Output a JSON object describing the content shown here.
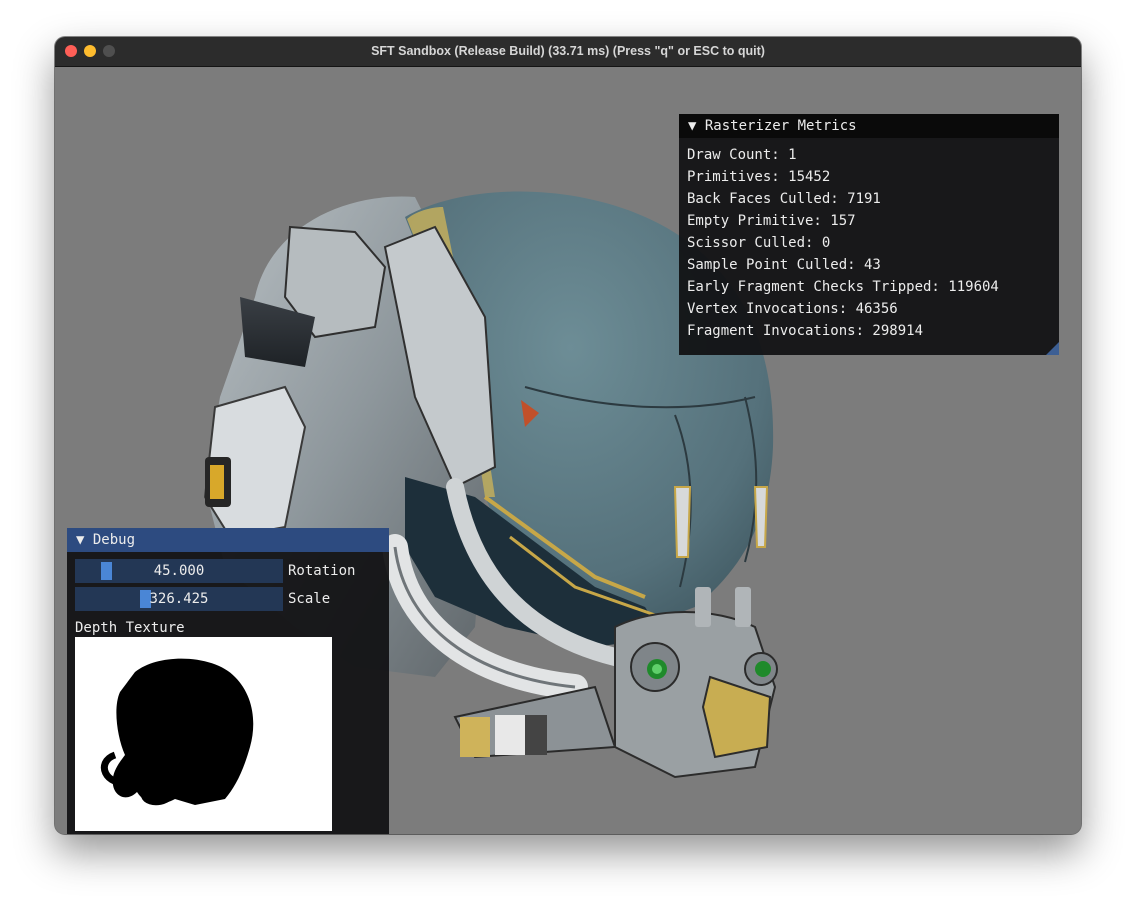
{
  "window": {
    "title": "SFT Sandbox (Release Build) (33.71 ms) (Press \"q\" or ESC to quit)"
  },
  "metrics_panel": {
    "header": "▼ Rasterizer Metrics",
    "rows": [
      "Draw Count: 1",
      "Primitives: 15452",
      "Back Faces Culled: 7191",
      "Empty Primitive: 157",
      "Scissor Culled: 0",
      "Sample Point Culled: 43",
      "Early Fragment Checks Tripped: 119604",
      "Vertex Invocations: 46356",
      "Fragment Invocations: 298914"
    ]
  },
  "debug_panel": {
    "header": "▼ Debug",
    "rotation": {
      "value": "45.000",
      "label": "Rotation"
    },
    "scale": {
      "value": "326.425",
      "label": "Scale"
    },
    "depth_label": "Depth Texture"
  },
  "colors": {
    "viewport_bg": "#7c7c7c",
    "titlebar": "#2c2c2c",
    "debug_header": "#2d4b80",
    "slider_bg": "#233755",
    "slider_grab": "#4a86d6",
    "visor": "#5e7a84"
  }
}
